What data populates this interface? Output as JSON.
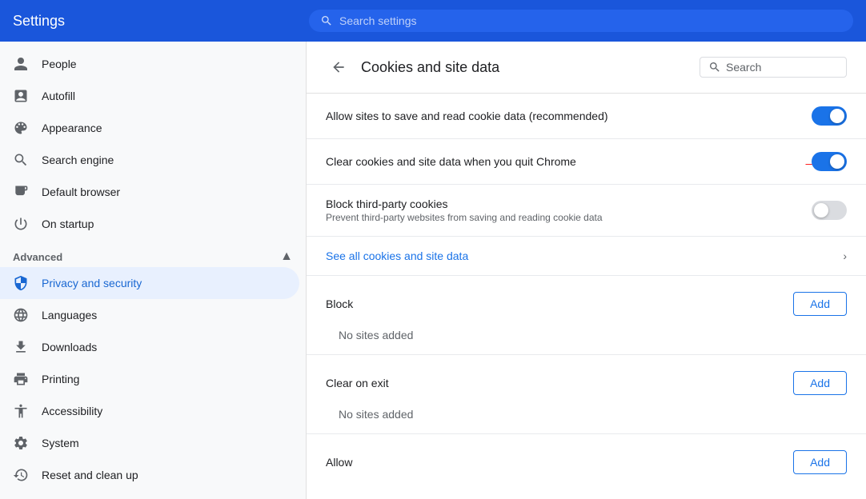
{
  "topbar": {
    "title": "Settings",
    "search_placeholder": "Search settings"
  },
  "sidebar": {
    "items": [
      {
        "id": "people",
        "label": "People",
        "icon": "person"
      },
      {
        "id": "autofill",
        "label": "Autofill",
        "icon": "assignment"
      },
      {
        "id": "appearance",
        "label": "Appearance",
        "icon": "palette"
      },
      {
        "id": "search-engine",
        "label": "Search engine",
        "icon": "search"
      },
      {
        "id": "default-browser",
        "label": "Default browser",
        "icon": "monitor"
      },
      {
        "id": "on-startup",
        "label": "On startup",
        "icon": "power"
      }
    ],
    "advanced_section": "Advanced",
    "advanced_items": [
      {
        "id": "privacy",
        "label": "Privacy and security",
        "icon": "shield",
        "active": true
      },
      {
        "id": "languages",
        "label": "Languages",
        "icon": "globe"
      },
      {
        "id": "downloads",
        "label": "Downloads",
        "icon": "download"
      },
      {
        "id": "printing",
        "label": "Printing",
        "icon": "print"
      },
      {
        "id": "accessibility",
        "label": "Accessibility",
        "icon": "accessibility"
      },
      {
        "id": "system",
        "label": "System",
        "icon": "settings"
      },
      {
        "id": "reset",
        "label": "Reset and clean up",
        "icon": "history"
      }
    ]
  },
  "content": {
    "title": "Cookies and site data",
    "search_placeholder": "Search",
    "settings": [
      {
        "id": "allow-cookies",
        "label": "Allow sites to save and read cookie data (recommended)",
        "enabled": true
      },
      {
        "id": "clear-on-exit",
        "label": "Clear cookies and site data when you quit Chrome",
        "enabled": true,
        "has_arrow": true
      },
      {
        "id": "block-third-party",
        "label": "Block third-party cookies",
        "sublabel": "Prevent third-party websites from saving and reading cookie data",
        "enabled": false
      }
    ],
    "see_all_label": "See all cookies and site data",
    "block_section": {
      "label": "Block",
      "add_label": "Add",
      "empty_label": "No sites added"
    },
    "clear_on_exit_section": {
      "label": "Clear on exit",
      "add_label": "Add",
      "empty_label": "No sites added"
    },
    "allow_section": {
      "label": "Allow",
      "add_label": "Add"
    }
  }
}
